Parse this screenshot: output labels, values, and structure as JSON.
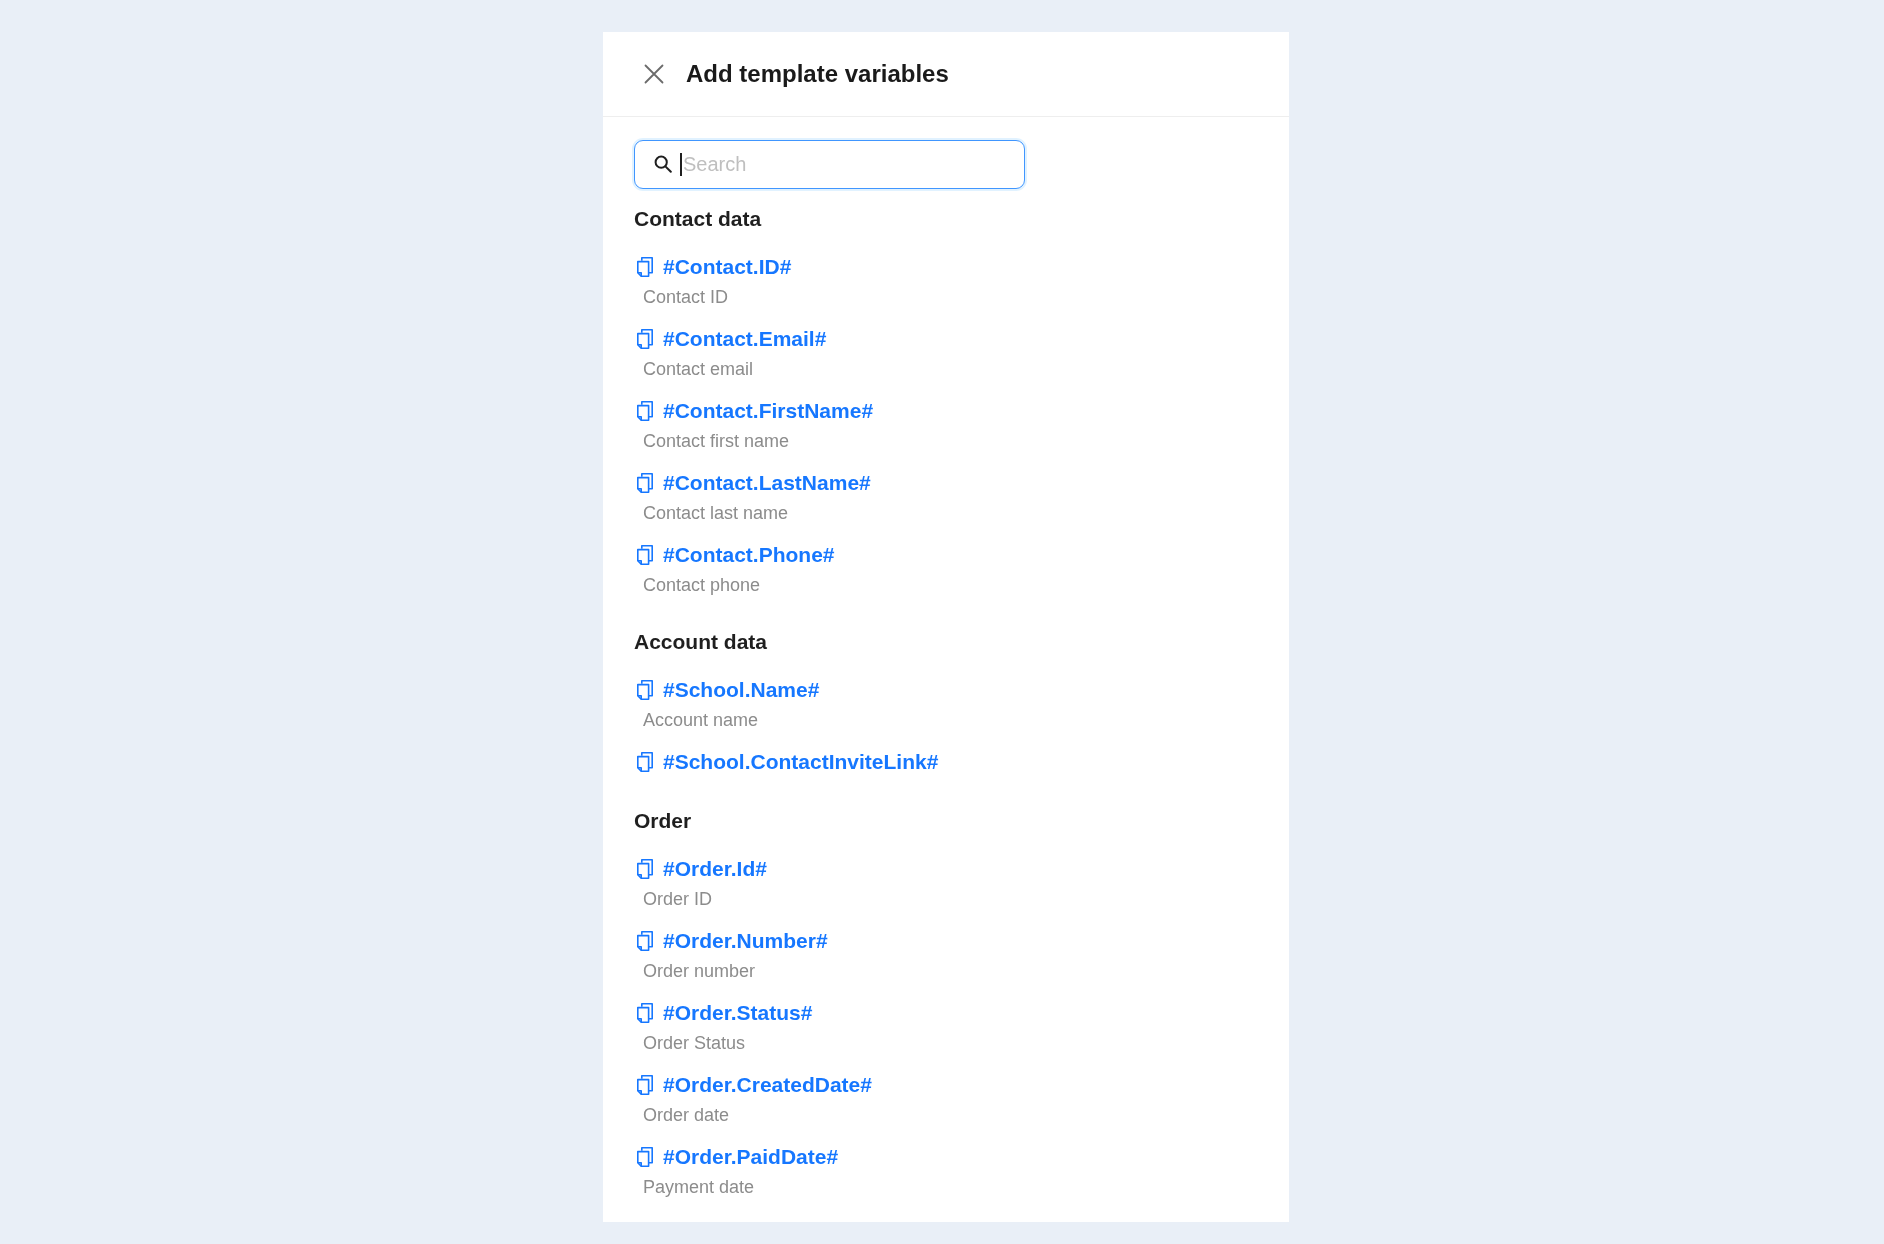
{
  "dialog": {
    "title": "Add template variables"
  },
  "search": {
    "placeholder": "Search",
    "focused": true
  },
  "groups": [
    {
      "heading": "Contact data",
      "variables": [
        {
          "code": "#Contact.ID#",
          "description": "Contact ID"
        },
        {
          "code": "#Contact.Email#",
          "description": "Contact email"
        },
        {
          "code": "#Contact.FirstName#",
          "description": "Contact first name"
        },
        {
          "code": "#Contact.LastName#",
          "description": "Contact last name"
        },
        {
          "code": "#Contact.Phone#",
          "description": "Contact phone"
        }
      ]
    },
    {
      "heading": "Account data",
      "variables": [
        {
          "code": "#School.Name#",
          "description": "Account name"
        },
        {
          "code": "#School.ContactInviteLink#"
        }
      ]
    },
    {
      "heading": "Order",
      "variables": [
        {
          "code": "#Order.Id#",
          "description": "Order ID"
        },
        {
          "code": "#Order.Number#",
          "description": "Order number"
        },
        {
          "code": "#Order.Status#",
          "description": "Order Status"
        },
        {
          "code": "#Order.CreatedDate#",
          "description": "Order date"
        },
        {
          "code": "#Order.PaidDate#",
          "description": "Payment date"
        }
      ]
    }
  ]
}
